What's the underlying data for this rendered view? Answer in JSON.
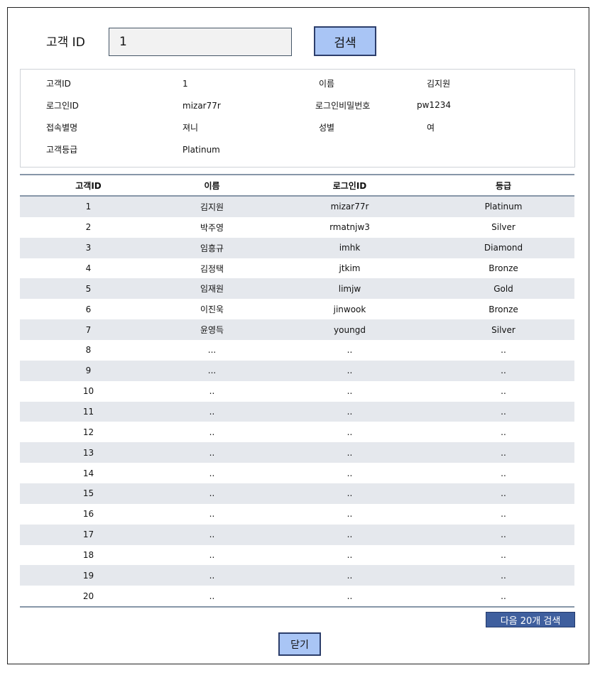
{
  "search": {
    "label": "고객 ID",
    "value": "1",
    "button_label": "검색"
  },
  "detail": {
    "customer_id_label": "고객ID",
    "customer_id_value": "1",
    "name_label": "이름",
    "name_value": "김지원",
    "login_id_label": "로그인ID",
    "login_id_value": "mizar77r",
    "login_pw_label": "로그인비밀번호",
    "login_pw_value": "pw1234",
    "nickname_label": "접속별명",
    "nickname_value": "져니",
    "gender_label": "성별",
    "gender_value": "여",
    "grade_label": "고객등급",
    "grade_value": "Platinum"
  },
  "table": {
    "headers": [
      "고객ID",
      "이름",
      "로그인ID",
      "등급"
    ],
    "rows": [
      [
        "1",
        "김지원",
        "mizar77r",
        "Platinum"
      ],
      [
        "2",
        "박주영",
        "rmatnjw3",
        "Silver"
      ],
      [
        "3",
        "임흥규",
        "imhk",
        "Diamond"
      ],
      [
        "4",
        "김정택",
        "jtkim",
        "Bronze"
      ],
      [
        "5",
        "임재원",
        "limjw",
        "Gold"
      ],
      [
        "6",
        "이진욱",
        "jinwook",
        "Bronze"
      ],
      [
        "7",
        "윤영득",
        "youngd",
        "Silver"
      ],
      [
        "8",
        "...",
        "..",
        ".."
      ],
      [
        "9",
        "...",
        "..",
        ".."
      ],
      [
        "10",
        "..",
        "..",
        ".."
      ],
      [
        "11",
        "..",
        "..",
        ".."
      ],
      [
        "12",
        "..",
        "..",
        ".."
      ],
      [
        "13",
        "..",
        "..",
        ".."
      ],
      [
        "14",
        "..",
        "..",
        ".."
      ],
      [
        "15",
        "..",
        "..",
        ".."
      ],
      [
        "16",
        "..",
        "..",
        ".."
      ],
      [
        "17",
        "..",
        "..",
        ".."
      ],
      [
        "18",
        "..",
        "..",
        ".."
      ],
      [
        "19",
        "..",
        "..",
        ".."
      ],
      [
        "20",
        "..",
        "..",
        ".."
      ]
    ]
  },
  "footer": {
    "next_label": "다음 20개 검색",
    "close_label": "닫기"
  }
}
